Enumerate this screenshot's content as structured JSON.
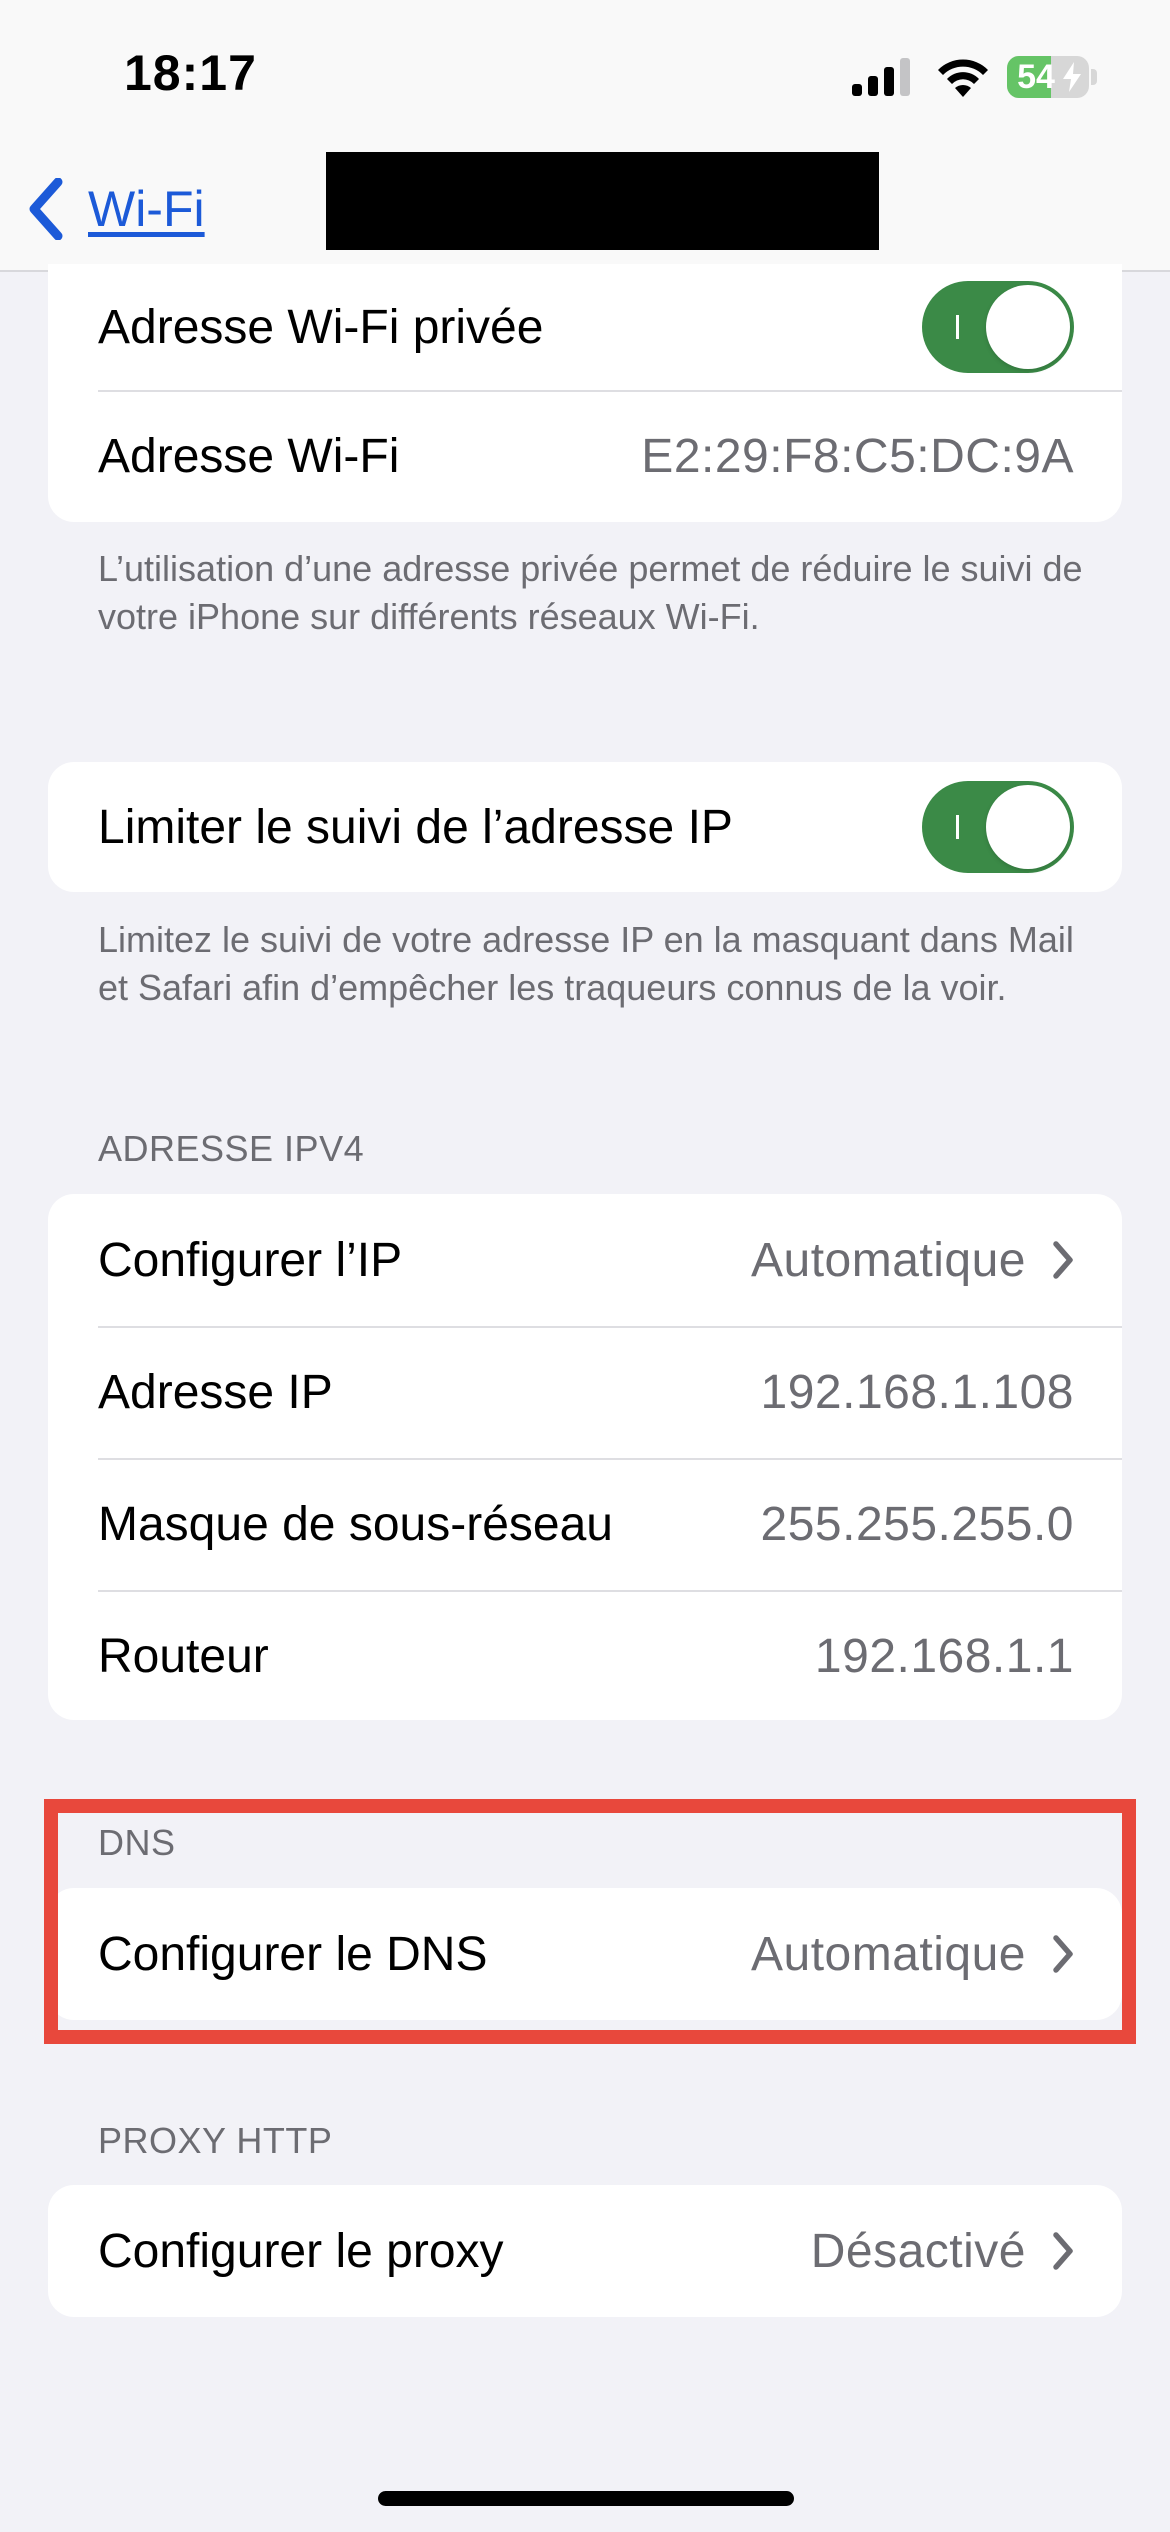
{
  "status_bar": {
    "time": "18:17",
    "battery_level": "54",
    "battery_fraction": 0.54,
    "icons": [
      "cellular-signal-icon",
      "wifi-icon",
      "battery-charging-icon"
    ]
  },
  "nav": {
    "back_label": "Wi-Fi",
    "title_redacted": true
  },
  "private_address": {
    "rows": [
      {
        "label": "Adresse Wi-Fi privée",
        "toggle": true
      },
      {
        "label": "Adresse Wi-Fi",
        "value": "E2:29:F8:C5:DC:9A"
      }
    ],
    "footer": "L’utilisation d’une adresse privée permet de réduire le suivi de votre iPhone sur différents réseaux Wi-Fi."
  },
  "limit_ip": {
    "label": "Limiter le suivi de l’adresse IP",
    "toggle": true,
    "footer": "Limitez le suivi de votre adresse IP en la masquant dans Mail et Safari afin d’empêcher les traqueurs connus de la voir."
  },
  "ipv4": {
    "header": "ADRESSE IPV4",
    "rows": [
      {
        "label": "Configurer l’IP",
        "value": "Automatique",
        "chevron": true
      },
      {
        "label": "Adresse IP",
        "value": "192.168.1.108"
      },
      {
        "label": "Masque de sous-réseau",
        "value": "255.255.255.0"
      },
      {
        "label": "Routeur",
        "value": "192.168.1.1"
      }
    ]
  },
  "dns": {
    "header": "DNS",
    "label": "Configurer le DNS",
    "value": "Automatique",
    "highlighted": true
  },
  "proxy": {
    "header": "PROXY HTTP",
    "label": "Configurer le proxy",
    "value": "Désactivé"
  },
  "colors": {
    "background": "#f2f2f7",
    "accent": "#1c5ad8",
    "toggle_on": "#3b8a47",
    "highlight": "#e8483c",
    "secondary_text": "#6c6c72"
  }
}
